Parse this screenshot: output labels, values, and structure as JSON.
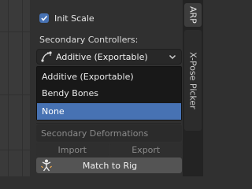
{
  "panel": {
    "init_scale_label": "Init Scale",
    "init_scale_checked": true,
    "secondary_controllers_label": "Secondary Controllers:",
    "select_value": "Additive (Exportable)",
    "dropdown_options": [
      "Additive (Exportable)",
      "Bendy Bones",
      "None"
    ],
    "highlighted_option": "None",
    "secondary_deformations_label": "Secondary Deformations",
    "import_label": "Import",
    "export_label": "Export",
    "match_to_rig_label": "Match to Rig"
  },
  "tabs": {
    "arp": "ARP",
    "xpose": "X-Pose Picker"
  },
  "colors": {
    "accent": "#4772b3",
    "panel_bg": "#303030",
    "menu_bg": "#181818"
  },
  "icons": [
    "checkmark-icon",
    "bone-curve-icon",
    "chevron-down-icon",
    "armature-pose-icon"
  ]
}
